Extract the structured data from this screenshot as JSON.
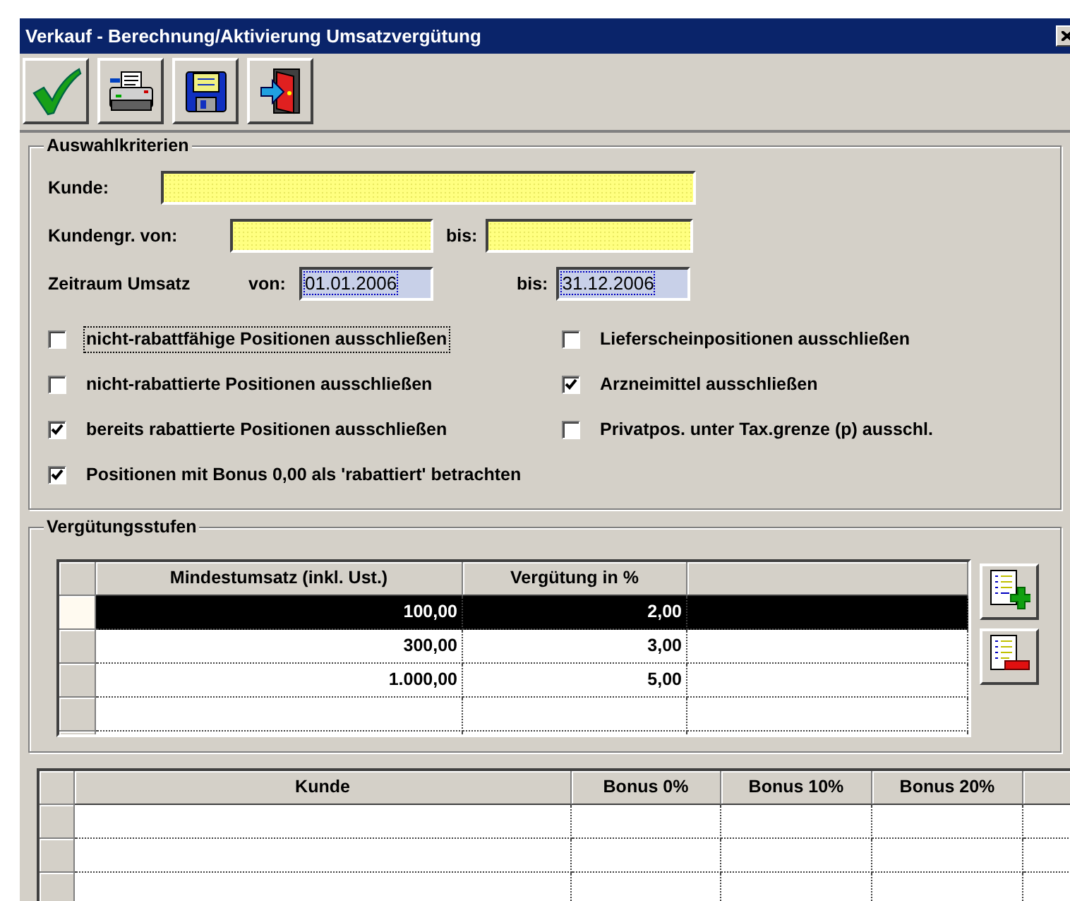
{
  "window": {
    "title": "Verkauf - Berechnung/Aktivierung Umsatzvergütung"
  },
  "toolbar": [
    {
      "kind": "check"
    },
    {
      "kind": "print"
    },
    {
      "kind": "save"
    },
    {
      "kind": "exit"
    }
  ],
  "criteria": {
    "title": "Auswahlkriterien",
    "kunde": {
      "label": "Kunde:"
    },
    "kundengruppe": {
      "label": "Kundengr. von:",
      "to_label": "bis:"
    },
    "zeitraum": {
      "label": "Zeitraum Umsatz",
      "from_label": "von:",
      "from": "01.01.2006",
      "to_label": "bis:",
      "to": "31.12.2006"
    },
    "checkboxes": [
      {
        "label": "nicht-rabattfähige Positionen ausschließen",
        "checked": false,
        "focused": true
      },
      {
        "label": "Lieferscheinpositionen ausschließen",
        "checked": false,
        "focused": false
      },
      {
        "label": "nicht-rabattierte Positionen ausschließen",
        "checked": false,
        "focused": false
      },
      {
        "label": "Arzneimittel ausschließen",
        "checked": true,
        "focused": false
      },
      {
        "label": "bereits rabattierte Positionen ausschließen",
        "checked": true,
        "focused": false
      },
      {
        "label": "Privatpos. unter Tax.grenze (p) ausschl.",
        "checked": false,
        "focused": false
      },
      {
        "label": "Positionen mit Bonus 0,00 als 'rabattiert' betrachten",
        "checked": true,
        "focused": false
      }
    ]
  },
  "stufen": {
    "title": "Vergütungsstufen",
    "columns": [
      "Mindestumsatz (inkl. Ust.)",
      "Vergütung in %"
    ],
    "rows": [
      {
        "cells": [
          "100,00",
          "2,00"
        ],
        "selected": true
      },
      {
        "cells": [
          "300,00",
          "3,00"
        ],
        "selected": false
      },
      {
        "cells": [
          "1.000,00",
          "5,00"
        ],
        "selected": false
      }
    ],
    "buttons": [
      {
        "kind": "add"
      },
      {
        "kind": "remove"
      }
    ]
  },
  "bonus_table": {
    "columns": [
      "Kunde",
      "Bonus 0%",
      "Bonus 10%",
      "Bonus 20%"
    ]
  }
}
